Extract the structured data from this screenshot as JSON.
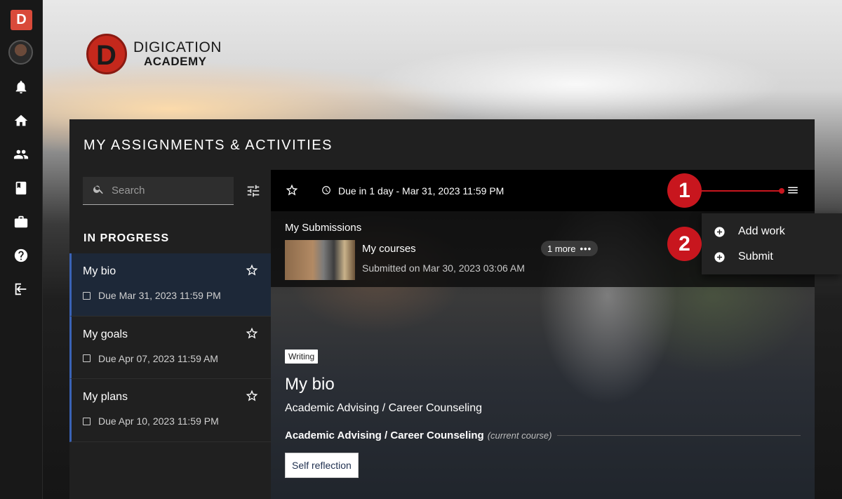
{
  "rail": {
    "logo_letter": "D",
    "icons": [
      "bell-icon",
      "home-icon",
      "people-icon",
      "book-icon",
      "briefcase-icon",
      "help-icon",
      "logout-icon"
    ]
  },
  "brand": {
    "line1": "DIGICATION",
    "line2": "ACADEMY",
    "mark": "D"
  },
  "panel": {
    "title": "MY ASSIGNMENTS & ACTIVITIES",
    "search_placeholder": "Search",
    "section_label": "IN PROGRESS",
    "items": [
      {
        "title": "My bio",
        "due": "Due Mar 31, 2023 11:59 PM",
        "active": true
      },
      {
        "title": "My goals",
        "due": "Due Apr 07, 2023 11:59 AM",
        "active": false
      },
      {
        "title": "My plans",
        "due": "Due Apr 10, 2023 11:59 PM",
        "active": false
      }
    ]
  },
  "detail": {
    "due_text": "Due in 1 day - Mar 31, 2023 11:59 PM",
    "submissions_label": "My Submissions",
    "submission_title": "My courses",
    "submission_date": "Submitted on Mar 30, 2023 03:06 AM",
    "more_label": "1 more",
    "more_dots": "•••",
    "tag": "Writing",
    "title": "My bio",
    "subtitle": "Academic Advising / Career Counseling",
    "course_name": "Academic Advising / Career Counseling",
    "course_note": "(current course)",
    "chip": "Self reflection"
  },
  "dropdown": {
    "items": [
      {
        "label": "Add work"
      },
      {
        "label": "Submit"
      }
    ]
  },
  "callouts": [
    "1",
    "2"
  ],
  "colors": {
    "accent_blue": "#3a63b6",
    "callout_red": "#c8161e",
    "logo_red": "#d94a3a"
  }
}
